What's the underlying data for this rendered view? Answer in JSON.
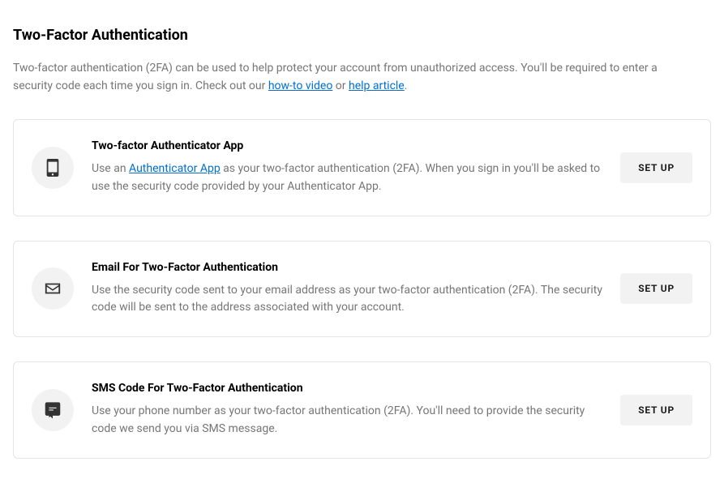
{
  "title": "Two-Factor Authentication",
  "intro": {
    "part1": "Two-factor authentication (2FA) can be used to help protect your account from unauthorized access. You'll be required to enter a security code each time you sign in. Check out our ",
    "link1": "how-to video",
    "part2": " or ",
    "link2": "help article",
    "part3": "."
  },
  "methods": [
    {
      "title": "Two-factor Authenticator App",
      "desc_pre": "Use an ",
      "desc_link": "Authenticator App",
      "desc_post": " as your two-factor authentication (2FA). When you sign in you'll be asked to use the security code provided by your Authenticator App.",
      "button": "SET UP"
    },
    {
      "title": "Email For Two-Factor Authentication",
      "desc": "Use the security code sent to your email address as your two-factor authentication (2FA). The security code will be sent to the address associated with your account.",
      "button": "SET UP"
    },
    {
      "title": "SMS Code For Two-Factor Authentication",
      "desc": "Use your phone number as your two-factor authentication (2FA). You'll need to provide the security code we send you via SMS message.",
      "button": "SET UP"
    }
  ]
}
